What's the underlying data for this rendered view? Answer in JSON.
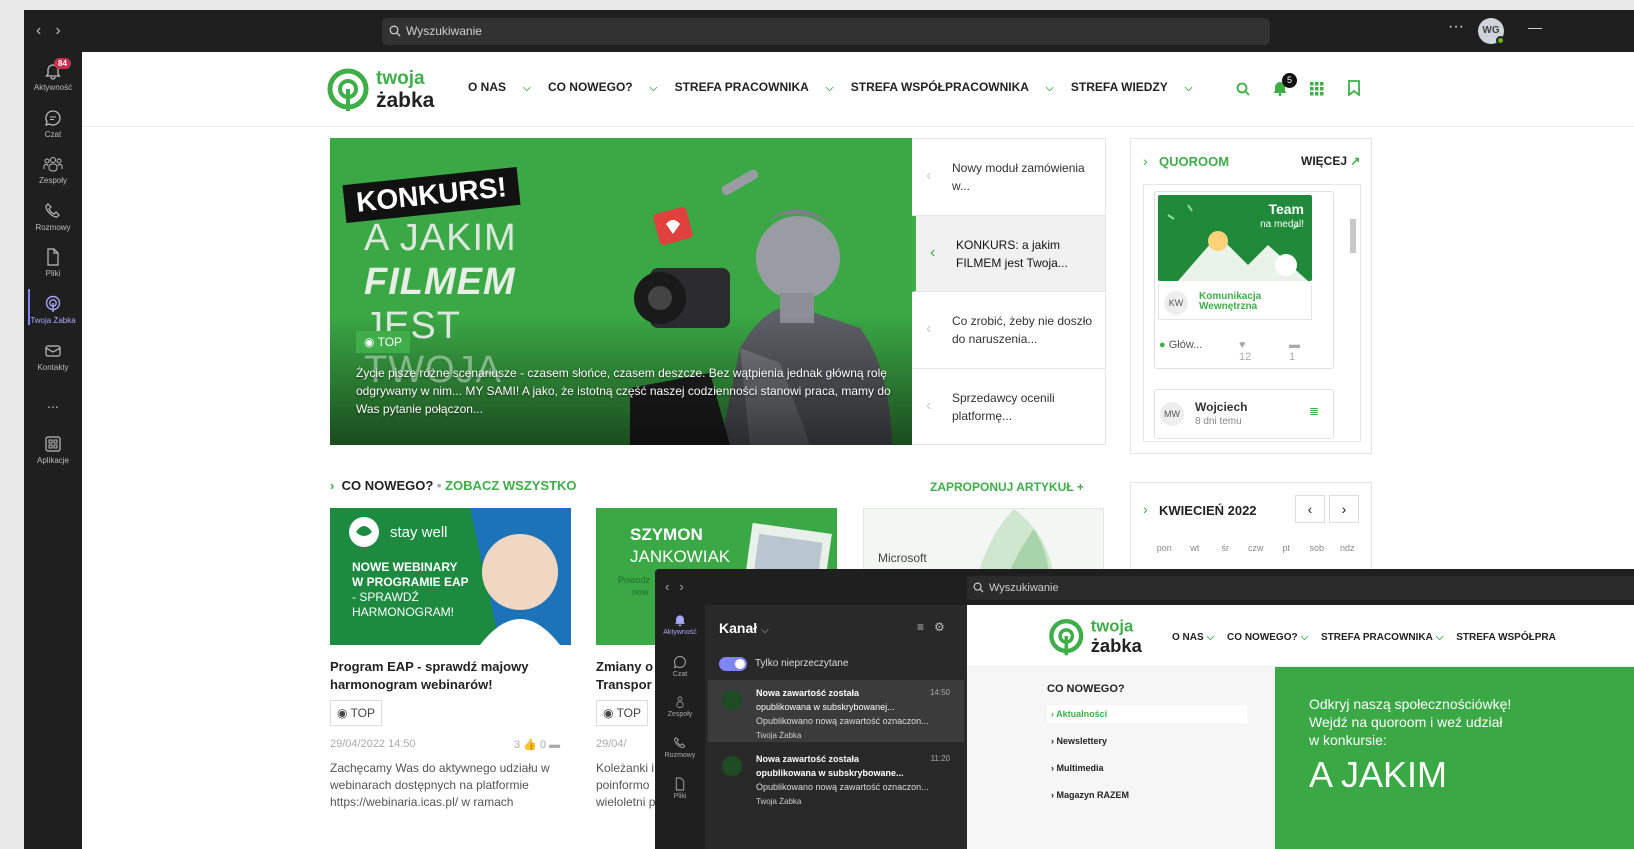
{
  "titlebar": {
    "search_placeholder": "Wyszukiwanie",
    "avatar_initials": "WG"
  },
  "rail": {
    "items": [
      {
        "label": "Aktywność",
        "badge": "84"
      },
      {
        "label": "Czat"
      },
      {
        "label": "Zespoły"
      },
      {
        "label": "Rozmowy"
      },
      {
        "label": "Pliki"
      },
      {
        "label": "Twoja Żabka"
      },
      {
        "label": "Kontakty"
      },
      {
        "label": "..."
      },
      {
        "label": "Aplikacje"
      }
    ]
  },
  "site": {
    "logo_line1": "twoja",
    "logo_line2": "żabka",
    "menu": [
      "O NAS",
      "CO NOWEGO?",
      "STREFA PRACOWNIKA",
      "STREFA WSPÓŁPRACOWNIKA",
      "STREFA WIEDZY"
    ],
    "bell_count": "5"
  },
  "hero": {
    "konkurs": "KONKURS!",
    "line1": "A JAKIM",
    "line2": "FILMEM",
    "line3": "JEST",
    "line4": "TWOJA",
    "tag": "TOP",
    "description": "Życie pisze różne scenariusze - czasem słońce, czasem deszcze. Bez wątpienia jednak główną rolę odgrywamy w nim... MY SAMI! A jako, że istotną część naszej codzienności stanowi praca, mamy do Was pytanie połączon..."
  },
  "slides": [
    {
      "text": "Nowy moduł zamówienia w..."
    },
    {
      "text": "KONKURS: a jakim FILMEM jest Twoja..."
    },
    {
      "text": "Co zrobić, żeby nie doszło do naruszenia..."
    },
    {
      "text": "Sprzedawcy ocenili platformę..."
    }
  ],
  "quoroom": {
    "title_a": "QUO",
    "title_b": "ROOM",
    "more": "WIĘCEJ",
    "card": {
      "image_title": "Team",
      "image_subtitle": "na medal!",
      "author_initials": "KW",
      "author_line1": "Komunikacja",
      "author_line2": "Wewnętrzna",
      "channel": "Głów...",
      "likes": "12",
      "comments": "1"
    },
    "card2": {
      "initials": "MW",
      "name": "Wojciech",
      "time": "8 dni temu"
    }
  },
  "news": {
    "heading": "CO NOWEGO?",
    "see_all": "ZOBACZ WSZYSTKO",
    "propose": "ZAPROPONUJ ARTYKUŁ",
    "articles": [
      {
        "img_brand": "stay well",
        "img_text1": "NOWE WEBINARY",
        "img_text2": "W PROGRAMIE EAP",
        "img_text3": "- SPRAWDŹ",
        "img_text4": "HARMONOGRAM!",
        "title1": "Program EAP - sprawdź majowy",
        "title2": "harmonogram webinarów!",
        "tag": "TOP",
        "date": "29/04/2022 14:50",
        "likes": "3",
        "comments": "0",
        "excerpt1": "Zachęcamy Was do aktywnego udziału w",
        "excerpt2": "webinarach dostępnych na platformie",
        "excerpt3": "https://webinaria.icas.pl/ w ramach"
      },
      {
        "img_text1": "SZYMON",
        "img_text2": "JANKOWIAK",
        "img_text3": "Powodz",
        "img_text4": "now",
        "title1": "Zmiany o",
        "title2": "Transpor",
        "tag": "TOP",
        "date": "29/04/",
        "excerpt1": "Koleżanki i",
        "excerpt2": "poinformo",
        "excerpt3": "wieloletni p"
      },
      {
        "img_text1": "Microsoft"
      }
    ]
  },
  "calendar": {
    "month": "KWIECIEŃ 2022",
    "days": [
      "pon",
      "wt",
      "śr",
      "czw",
      "pt",
      "sob",
      "ndz"
    ]
  },
  "overlay": {
    "search_placeholder": "Wyszukiwanie",
    "rail": [
      "Aktywność",
      "Czat",
      "Zespoły",
      "Rozmowy",
      "Pliki"
    ],
    "panel_title": "Kanał",
    "toggle_label": "Tylko nieprzeczytane",
    "notifications": [
      {
        "title1": "Nowa zawartość została",
        "title2": "opublikowana w subskrybowanej...",
        "time": "14:50",
        "preview": "Opublikowano nową zawartość oznaczon...",
        "source": "Twoja Żabka"
      },
      {
        "title1": "Nowa zawartość została",
        "title2": "opublikowana w subskrybowane...",
        "time": "11:20",
        "preview": "Opublikowano nową zawartość oznaczon...",
        "source": "Twoja Żabka"
      }
    ],
    "web_menu": [
      "O NAS",
      "CO NOWEGO?",
      "STREFA PRACOWNIKA",
      "STREFA WSPÓŁPRA"
    ],
    "side_title": "CO NOWEGO?",
    "side_items": [
      "Aktualności",
      "Newslettery",
      "Multimedia",
      "Magazyn RAZEM"
    ],
    "banner_line1": "Odkryj naszą społecznościówkę!",
    "banner_line2": "Wejdź na quoroom i weź udział",
    "banner_line3": "w konkursie:",
    "banner_big": "A JAKIM"
  },
  "colors": {
    "brand_green": "#3fae49",
    "teams_dark": "#1f1f1f",
    "teams_accent": "#7f85f5"
  }
}
